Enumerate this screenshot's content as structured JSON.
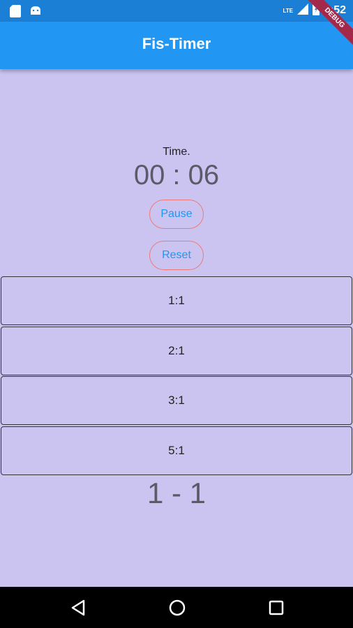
{
  "status_bar": {
    "time": "6:52",
    "network": "LTE",
    "icons": [
      "sd-card-icon",
      "android-icon",
      "signal-icon",
      "battery-icon"
    ]
  },
  "app_bar": {
    "title": "Fis-Timer",
    "color": "#2196f3"
  },
  "debug_banner": "DEBUG",
  "timer": {
    "label": "Time.",
    "value": "00 : 06"
  },
  "controls": {
    "pause_label": "Pause",
    "reset_label": "Reset"
  },
  "ratios": [
    "1:1",
    "2:1",
    "3:1",
    "5:1"
  ],
  "score": "1 - 1",
  "nav": {
    "icons": [
      "back-icon",
      "home-icon",
      "recents-icon"
    ]
  },
  "colors": {
    "background": "#cbc3f0",
    "accent": "#2196f3",
    "button_border": "#f07a7a"
  }
}
